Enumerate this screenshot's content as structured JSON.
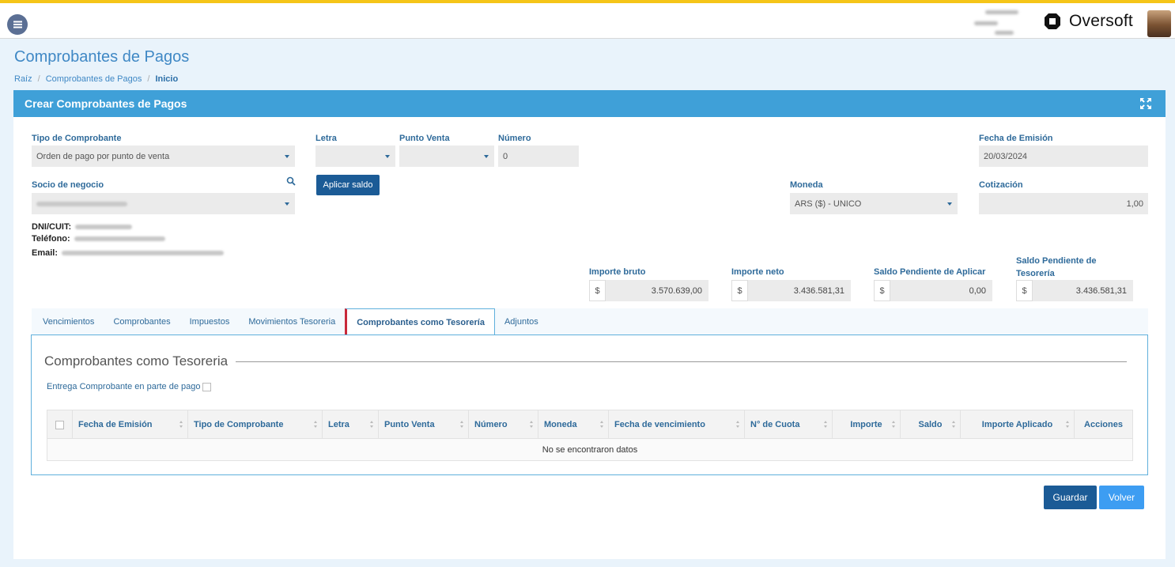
{
  "header": {
    "brand": "Oversoft"
  },
  "page": {
    "title": "Comprobantes de Pagos",
    "breadcrumb": [
      "Raíz",
      "Comprobantes de Pagos",
      "Inicio"
    ]
  },
  "card": {
    "title": "Crear Comprobantes de Pagos"
  },
  "form": {
    "tipo_comprobante": {
      "label": "Tipo de Comprobante",
      "value": "Orden de pago por punto de venta"
    },
    "letra": {
      "label": "Letra",
      "value": ""
    },
    "punto_venta": {
      "label": "Punto Venta",
      "value": ""
    },
    "numero": {
      "label": "Número",
      "value": "0"
    },
    "fecha_emision": {
      "label": "Fecha de Emisión",
      "value": "20/03/2024"
    },
    "socio": {
      "label": "Socio de negocio"
    },
    "aplicar_saldo": "Aplicar saldo",
    "moneda": {
      "label": "Moneda",
      "value": "ARS ($) - UNICO"
    },
    "cotizacion": {
      "label": "Cotización",
      "value": "1,00"
    },
    "dni_label": "DNI/CUIT:",
    "telefono_label": "Teléfono:",
    "email_label": "Email:"
  },
  "totals": {
    "currency_symbol": "$",
    "importe_bruto": {
      "label": "Importe bruto",
      "value": "3.570.639,00"
    },
    "importe_neto": {
      "label": "Importe neto",
      "value": "3.436.581,31"
    },
    "saldo_aplicar": {
      "label": "Saldo Pendiente de Aplicar",
      "value": "0,00"
    },
    "saldo_tesoreria": {
      "label": "Saldo Pendiente de Tesorería",
      "value": "3.436.581,31"
    }
  },
  "tabs": [
    "Vencimientos",
    "Comprobantes",
    "Impuestos",
    "Movimientos Tesoreria",
    "Comprobantes como Tesorería",
    "Adjuntos"
  ],
  "panel": {
    "legend": "Comprobantes como Tesoreria",
    "checkbox_label": "Entrega Comprobante en parte de pago",
    "columns": [
      "Fecha de Emisión",
      "Tipo de Comprobante",
      "Letra",
      "Punto Venta",
      "Número",
      "Moneda",
      "Fecha de vencimiento",
      "N° de Cuota",
      "Importe",
      "Saldo",
      "Importe Aplicado",
      "Acciones"
    ],
    "empty_message": "No se encontraron datos"
  },
  "actions": {
    "guardar": "Guardar",
    "volver": "Volver"
  },
  "colors": {
    "accent": "#3fa0d8",
    "primary_button": "#1b5b96",
    "secondary_button": "#3d9df2",
    "top_border": "#f5c518",
    "active_tab_marker": "#c8293a"
  }
}
